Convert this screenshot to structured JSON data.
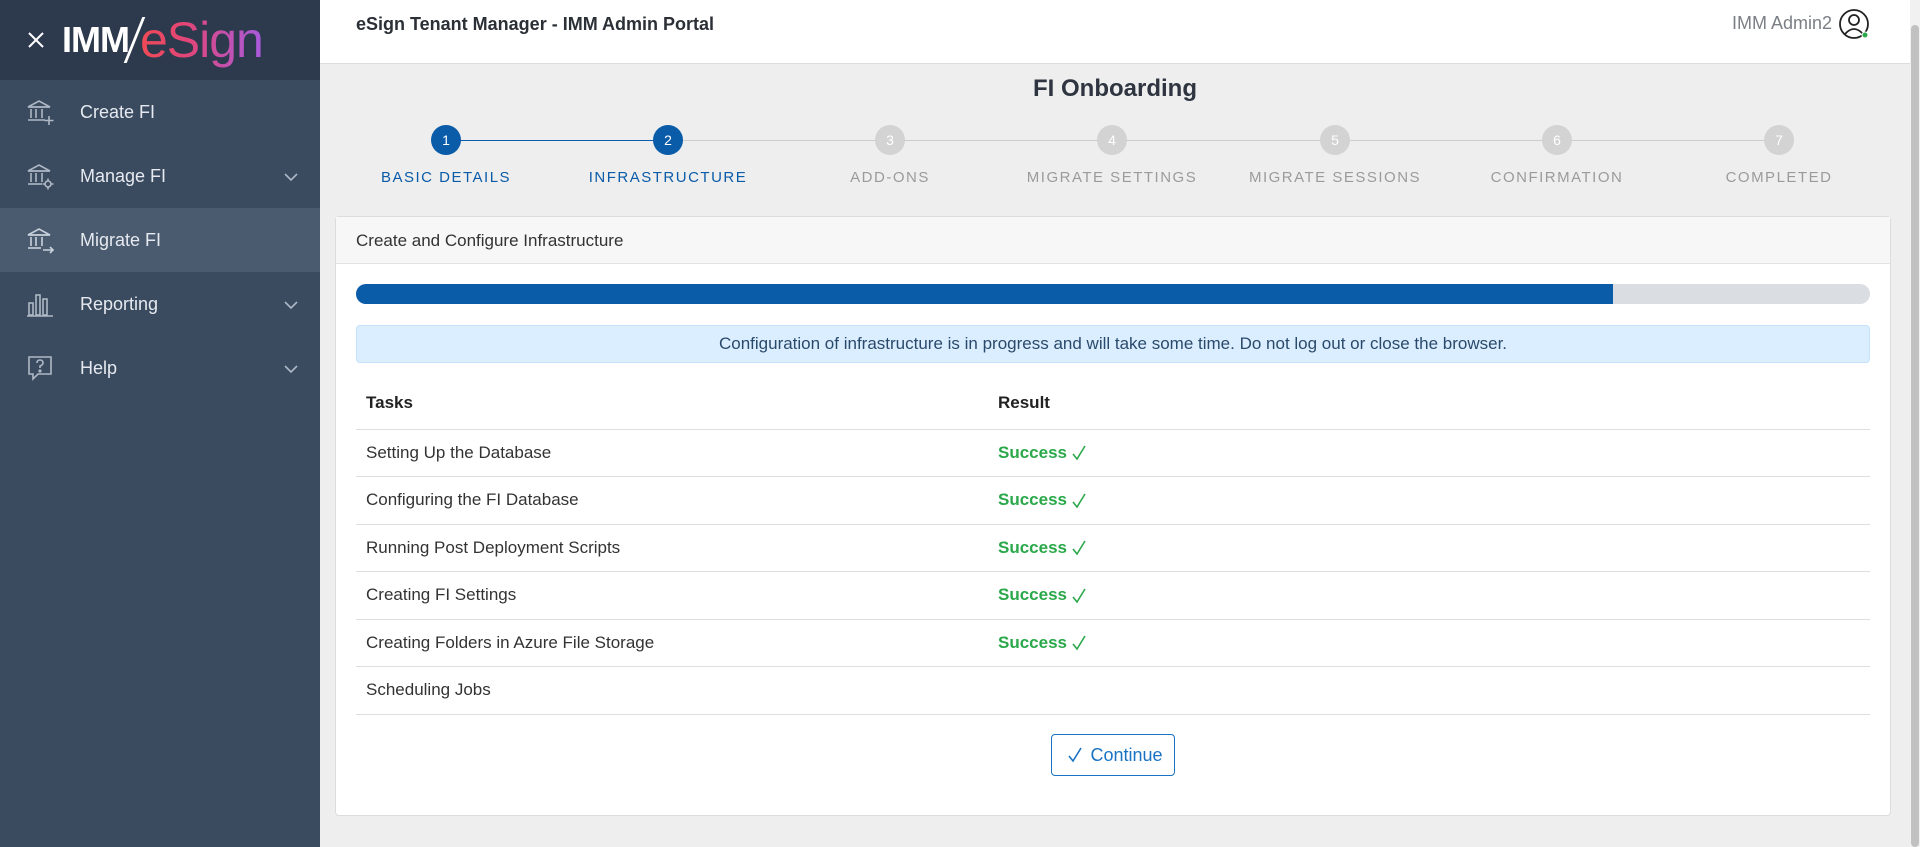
{
  "sidebar": {
    "logo_left": "IMM",
    "logo_right": "eSign",
    "items": [
      {
        "label": "Create FI",
        "icon": "bank-plus-icon",
        "expandable": false,
        "active": false
      },
      {
        "label": "Manage FI",
        "icon": "bank-gear-icon",
        "expandable": true,
        "active": false
      },
      {
        "label": "Migrate FI",
        "icon": "bank-arrow-icon",
        "expandable": false,
        "active": true
      },
      {
        "label": "Reporting",
        "icon": "bar-chart-icon",
        "expandable": true,
        "active": false
      },
      {
        "label": "Help",
        "icon": "help-bubble-icon",
        "expandable": true,
        "active": false
      }
    ]
  },
  "header": {
    "title": "eSign Tenant Manager - IMM Admin Portal",
    "user_name": "IMM Admin2"
  },
  "page": {
    "heading": "FI Onboarding"
  },
  "stepper": {
    "current": 2,
    "steps": [
      {
        "number": "1",
        "label": "BASIC DETAILS"
      },
      {
        "number": "2",
        "label": "INFRASTRUCTURE"
      },
      {
        "number": "3",
        "label": "ADD-ONS"
      },
      {
        "number": "4",
        "label": "MIGRATE SETTINGS"
      },
      {
        "number": "5",
        "label": "MIGRATE SESSIONS"
      },
      {
        "number": "6",
        "label": "CONFIRMATION"
      },
      {
        "number": "7",
        "label": "COMPLETED"
      }
    ]
  },
  "card": {
    "title": "Create and Configure Infrastructure",
    "progress_percent": 83,
    "alert": "Configuration of infrastructure is in progress and will take some time. Do not log out or close the browser.",
    "table": {
      "headers": [
        "Tasks",
        "Result"
      ],
      "rows": [
        {
          "task": "Setting Up the Database",
          "result": "Success"
        },
        {
          "task": "Configuring the FI Database",
          "result": "Success"
        },
        {
          "task": "Running Post Deployment Scripts",
          "result": "Success"
        },
        {
          "task": "Creating FI Settings",
          "result": "Success"
        },
        {
          "task": "Creating Folders in Azure File Storage",
          "result": "Success"
        },
        {
          "task": "Scheduling Jobs",
          "result": ""
        }
      ]
    },
    "continue_label": "Continue"
  },
  "colors": {
    "primary": "#0a5ba8",
    "success": "#2aa84a",
    "sidebar": "#3a4a5f"
  }
}
